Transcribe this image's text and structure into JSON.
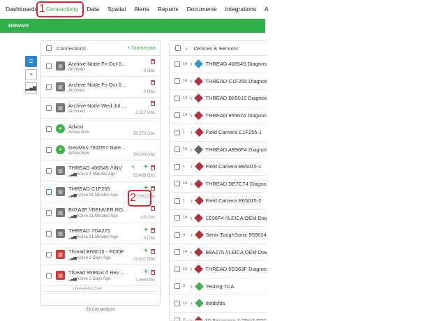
{
  "nav": {
    "items": [
      "Dashboards",
      "Connectivity",
      "Data",
      "Spatial",
      "Alerts",
      "Reports",
      "Documents",
      "Integrations",
      "A"
    ],
    "active_index": 1
  },
  "annotations": {
    "one": "1",
    "two": "2"
  },
  "subnav": {
    "tab": "Network"
  },
  "side_buttons": [
    "list-icon",
    "tree-icon",
    "signal-icon"
  ],
  "left_panel": {
    "title": "Connections",
    "add_label": "+ Connection",
    "rows": [
      {
        "name": "Archive Node Fri Oct 0...",
        "sub": "Archived",
        "obs": "0 Obs",
        "icon": "gray",
        "actions": "trash"
      },
      {
        "name": "Archive Node Fri Oct 0...",
        "sub": "Archived",
        "obs": "0 Obs",
        "icon": "gray",
        "actions": "trash"
      },
      {
        "name": "Archive Node Wed Jul ...",
        "sub": "Archived",
        "obs": "1,517 Obs",
        "icon": "gray",
        "actions": "trash"
      },
      {
        "name": "Advoo",
        "sub": "Active Now",
        "obs": "58,375 Obs",
        "icon": "green",
        "actions": ""
      },
      {
        "name": "GeoMos 782DF7 Nate...",
        "sub": "Active Now",
        "obs": "94,109 Obs",
        "icon": "green",
        "actions": ""
      },
      {
        "name": "THREAD 406545 //INV",
        "sub": "Active 4 Minutes Ago",
        "obs": "63,436 Obs",
        "icon": "gray",
        "actions": "plus-trash",
        "pencil": true,
        "signal": true
      },
      {
        "name": "THREAD C1F255",
        "sub": "Active 31 Minutes Ago",
        "obs": "7,862 Obs",
        "icon": "gray",
        "actions": "plus-trash",
        "signal": true,
        "blue_cb": true
      },
      {
        "name": "B07A2F //DENVER RO...",
        "sub": "Active 31 Minutes Ago",
        "obs": "-19 Obs",
        "icon": "gray",
        "actions": "trash",
        "signal": true
      },
      {
        "name": "THREAD 7DA275",
        "sub": "Active 31 Minutes Ago",
        "obs": "0 Obs",
        "icon": "gray",
        "actions": "plus-trash",
        "signal": true
      },
      {
        "name": "Thread B65015 - ROOF",
        "sub": "Active 3 Days Ago",
        "obs": "22,027 Obs",
        "icon": "red",
        "actions": "plus-trash",
        "signal": true
      },
      {
        "name": "Thread 959624 // Rev ...",
        "sub": "Active 3 Days Ago",
        "obs": "1,668 Obs",
        "icon": "red",
        "actions": "plus-trash",
        "signal": true
      },
      {
        "name": "Thread 4D8554",
        "sub": "",
        "obs": "",
        "icon": "red",
        "actions": "",
        "partial": true
      }
    ],
    "footer": "26 Connections"
  },
  "right_panel": {
    "title": "Devices & Sensors",
    "rows": [
      {
        "num": "14",
        "name": "THREAD 406545 Diagnost",
        "color": "blue"
      },
      {
        "num": "14",
        "name": "THREAD C1F255 Diagnost",
        "color": "red"
      },
      {
        "num": "14",
        "name": "THREAD B65015 Diagnost",
        "color": "red"
      },
      {
        "num": "14",
        "name": "THREAD 959624 Diagnost",
        "color": "red"
      },
      {
        "num": "1",
        "name": "Field Camera C1F255-1",
        "color": "red"
      },
      {
        "num": "14",
        "name": "THREAD AB96F4 Diagnost",
        "color": "gray"
      },
      {
        "num": "1",
        "name": "Field Camera B65015-1",
        "color": "red"
      },
      {
        "num": "14",
        "name": "THREAD DE7C74 Diagnos",
        "color": "red"
      },
      {
        "num": "1",
        "name": "Field Camera B65015-2",
        "color": "red"
      },
      {
        "num": "14",
        "name": "1E96F4 //LEICA OEM Diag",
        "color": "red"
      },
      {
        "num": "4",
        "name": "Senix ToughSonic 959624",
        "color": "red"
      },
      {
        "num": "14",
        "name": "B9A275 //LEICA OEM Diag",
        "color": "red"
      },
      {
        "num": "12",
        "name": "THREAD 5D363F Diagnost",
        "color": "red"
      },
      {
        "num": "3",
        "name": "Testing TCA",
        "color": "green"
      },
      {
        "num": "12",
        "name": "dsfdsfds",
        "color": "green"
      },
      {
        "num": "7",
        "name": "Multipurpose 4-20mA 5D36",
        "color": "red"
      }
    ]
  }
}
